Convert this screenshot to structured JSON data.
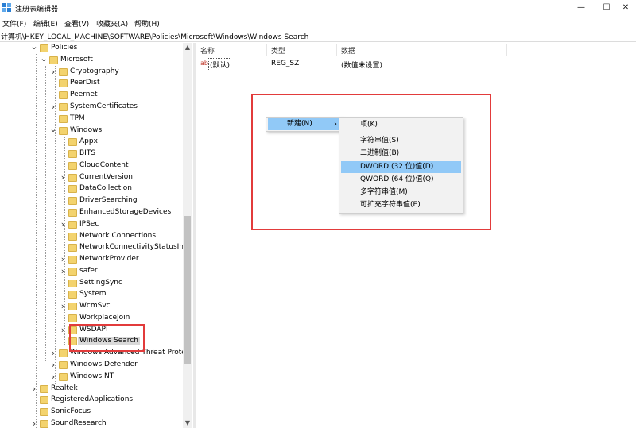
{
  "window": {
    "title": "注册表编辑器",
    "minimize": "—",
    "maximize": "☐",
    "close": "✕"
  },
  "menu": [
    "文件(F)",
    "编辑(E)",
    "查看(V)",
    "收藏夹(A)",
    "帮助(H)"
  ],
  "address": "计算机\\HKEY_LOCAL_MACHINE\\SOFTWARE\\Policies\\Microsoft\\Windows\\Windows Search",
  "tree": [
    {
      "label": "Policies",
      "expand": "v"
    },
    {
      "label": "Microsoft",
      "expand": "v"
    },
    {
      "label": "Cryptography",
      "expand": ">"
    },
    {
      "label": "PeerDist",
      "expand": ""
    },
    {
      "label": "Peernet",
      "expand": ""
    },
    {
      "label": "SystemCertificates",
      "expand": ">"
    },
    {
      "label": "TPM",
      "expand": ""
    },
    {
      "label": "Windows",
      "expand": "v"
    },
    {
      "label": "Appx",
      "expand": ""
    },
    {
      "label": "BITS",
      "expand": ""
    },
    {
      "label": "CloudContent",
      "expand": ""
    },
    {
      "label": "CurrentVersion",
      "expand": ">"
    },
    {
      "label": "DataCollection",
      "expand": ""
    },
    {
      "label": "DriverSearching",
      "expand": ""
    },
    {
      "label": "EnhancedStorageDevices",
      "expand": ""
    },
    {
      "label": "IPSec",
      "expand": ">"
    },
    {
      "label": "Network Connections",
      "expand": ""
    },
    {
      "label": "NetworkConnectivityStatusIndi",
      "expand": ""
    },
    {
      "label": "NetworkProvider",
      "expand": ">"
    },
    {
      "label": "safer",
      "expand": ">"
    },
    {
      "label": "SettingSync",
      "expand": ""
    },
    {
      "label": "System",
      "expand": ""
    },
    {
      "label": "WcmSvc",
      "expand": ">"
    },
    {
      "label": "WorkplaceJoin",
      "expand": ""
    },
    {
      "label": "WSDAPI",
      "expand": ">"
    },
    {
      "label": "Windows Search",
      "expand": ""
    },
    {
      "label": "Windows Advanced Threat Prote",
      "expand": ">"
    },
    {
      "label": "Windows Defender",
      "expand": ">"
    },
    {
      "label": "Windows NT",
      "expand": ">"
    },
    {
      "label": "Realtek",
      "expand": ">"
    },
    {
      "label": "RegisteredApplications",
      "expand": ""
    },
    {
      "label": "SonicFocus",
      "expand": ""
    },
    {
      "label": "SoundResearch",
      "expand": ">"
    }
  ],
  "list": {
    "columns": [
      "名称",
      "类型",
      "数据"
    ],
    "rows": [
      {
        "name": "(默认)",
        "type": "REG_SZ",
        "data": "(数值未设置)"
      }
    ]
  },
  "context_menu": {
    "new_item": "新建(N)",
    "arrow": "›",
    "submenu": [
      "项(K)",
      "字符串值(S)",
      "二进制值(B)",
      "DWORD (32 位)值(D)",
      "QWORD (64 位)值(Q)",
      "多字符串值(M)",
      "可扩充字符串值(E)"
    ]
  },
  "scroll": {
    "up": "▲",
    "down": "▼"
  },
  "colors": {
    "highlight": "#91c9f7",
    "annotation": "#e23b3b",
    "folder": "#f3d36e"
  }
}
